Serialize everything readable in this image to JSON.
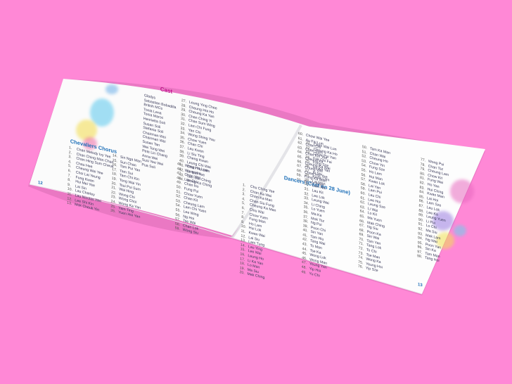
{
  "left_page": {
    "cast_title": "Cast",
    "cast_rows": [
      "Gladys",
      "Sebastian Bobadilla",
      "British MCs",
      "Tonia Lena",
      "Tonia Maroc",
      "Henrietta Soli",
      "",
      "Susan Soli",
      "",
      "Stefanie Soli",
      "Chairman Wei",
      "Chairman Wei",
      "Susan Tan",
      "Wei Tong Wei",
      "Pete Lin Chang",
      "Anna Wei",
      "Susi Yee Wei",
      "Pua Soli"
    ],
    "chorus_heading": "Chevaliers Chorus",
    "chorus_col1": [
      "Chan Melody Ivy Yee",
      "Chan Ching Man Chan",
      "Chan Hing Sum Cheuk",
      "Chau Hee",
      "Cheung Wei Yee",
      "Choi Lai Yeung",
      "Fung Kwan",
      "Hui Mei Yee",
      "Lai Sin",
      "Lau Charley",
      "Lau Nicolas Wei",
      "Lee Shi Kin",
      "Mok Cheuk Yin"
    ],
    "chorus_col2": [
      "Sin Nga Man",
      "Sun Chan",
      "Tam Pui Yan",
      "Tam Sui",
      "Tam Chi Kin",
      "Tong Wai Yin",
      "Tsui Pui Sum",
      "Wai Hing",
      "Wong Chi",
      "Wong Choi",
      "Wong Ka Yan",
      "Yam Ting",
      "Yuen Hoi Yan"
    ],
    "cast_col3": [
      "Leung Ying Chee",
      "Cheung Hoi Ho",
      "Cheung Ka Yan",
      "Chan Ching Yi",
      "Chan Sum Wing",
      "Lam Chi Fung",
      "Yan Chi",
      "Wong Shing Yau",
      "Chow Yuen",
      "Chan Chi",
      "Lau Kwan",
      "Li Siu Ting",
      "Cheng Kwan",
      "Leung Chi Wai",
      "Chan Yiu Lam",
      "Lo Mei Yee",
      "Tam Mei Ching",
      "Wong Ka Ching"
    ],
    "cast_col4": [
      "Wong Ho Lam",
      "Wong Hin",
      "Chan Wai",
      "Lau Chi",
      "Chan Ho",
      "Fung Pui",
      "Chow Yuen",
      "Chan Kit",
      "Cheung Lam",
      "Lam Chi Yuen",
      "Lee Wing",
      "Ng Hoi",
      "Tse Wai",
      "Chan Lok",
      "Wong Siu"
    ],
    "page_number": "12"
  },
  "right_page": {
    "col1": [
      "Chow Wai Yee",
      "Au Fai Lun",
      "Chan Chi",
      "Chan Sum",
      "Chan Kin Yee",
      "Cheung Kit",
      "Cheung Ka Wai",
      "Chung Wai",
      "Chow Hoi Yee",
      "Fung Ka Man",
      "Ho Ka Wing"
    ],
    "dancers_heading": "Dancers (Cast on 28 June)",
    "dancers": [
      "Chu Ching Yee",
      "Chan Ka Wai",
      "Chan Ka Man",
      "Chan Siu Fung",
      "Cheung Ka Man",
      "Chiu Wai",
      "Chow Yuen",
      "Fung Man",
      "Ho Lam",
      "Hui Lok",
      "Kwan Wai",
      "Lai Siu",
      "Lam Tung",
      "Lau Ying",
      "Lee Wai",
      "Leung Ho",
      "Li Ka Yan",
      "Lo Man",
      "Ma Siu",
      "Mak Ching"
    ],
    "col2": [
      "Chan Wai Lun",
      "Cheung Ka Ho",
      "Chow Pui Yan",
      "Fok Chi Fai",
      "Fong Sze",
      "Ho Ka Yan",
      "Ip Siu",
      "Kwok Lam",
      "Lai Man",
      "Lam Hoi",
      "Lau Kit",
      "Lee Lok",
      "Leung Wai",
      "Li Ching",
      "Lo Yuen",
      "Ma Ka",
      "Mok Tsz",
      "Ng Pui",
      "Poon Chi",
      "Sin Yan",
      "Tam Hiu",
      "Tang Wai",
      "To Man",
      "Tse Ka",
      "Wong Lok",
      "Wong Man",
      "Yeung Yan",
      "Yip Hoi",
      "Yu Chi"
    ],
    "col3": [
      "Tam Ka Man",
      "Chan Wai",
      "Cheung Ho",
      "Chow Yin",
      "Fung Sze",
      "Ho Lam",
      "Hui Man",
      "Kwan Lok",
      "Lai Yan",
      "Lam Pui",
      "Lau Chi",
      "Lee Hoi",
      "Leung Sze",
      "Li Wai",
      "Lo Kit",
      "Ma Yuen",
      "Mak Ching",
      "Ng Siu",
      "Poon Ka",
      "Sin Wai",
      "Tam Yan",
      "Tang Lok",
      "To Chi",
      "Tse Man",
      "Wong Ka",
      "Yeung Hoi",
      "Yip Sze"
    ],
    "col4": [
      "Wong Pui",
      "Chan Tsz",
      "Cheung Lam",
      "Chow Kit",
      "Fung Wai",
      "Ho Yan",
      "Hui Ching",
      "Kwan Man",
      "Lai Hoi",
      "Lam Sze",
      "Lau Lok",
      "Lee Ka",
      "Leung Yuen",
      "Li Pui",
      "Lo Chi",
      "Ma Siu",
      "Mak Lam",
      "Ng Wai",
      "Poon Yan",
      "Sin Ka",
      "Tam Man",
      "Tang Hoi"
    ],
    "page_number": "13"
  },
  "colors": {
    "background": "#ff88d6",
    "heading_blue": "#1d6fb8",
    "cast_magenta": "#c0128c",
    "paper": "#fbfbfb"
  }
}
